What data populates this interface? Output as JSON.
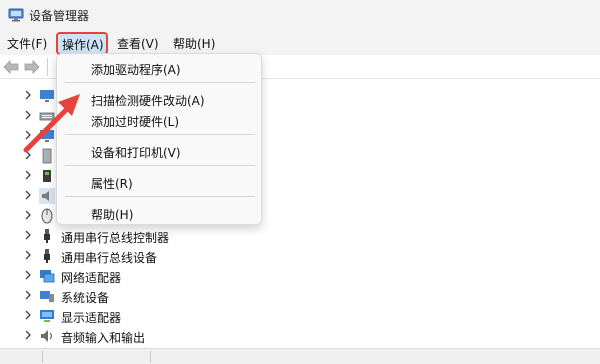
{
  "window": {
    "title": "设备管理器"
  },
  "menubar": {
    "items": [
      {
        "label": "文件(F)"
      },
      {
        "label": "操作(A)"
      },
      {
        "label": "查看(V)"
      },
      {
        "label": "帮助(H)"
      }
    ]
  },
  "action_menu": {
    "items": [
      {
        "label": "添加驱动程序(A)"
      },
      {
        "label": "扫描检测硬件改动(A)"
      },
      {
        "label": "添加过时硬件(L)"
      },
      {
        "label": "设备和打印机(V)"
      },
      {
        "label": "属性(R)"
      },
      {
        "label": "帮助(H)"
      }
    ]
  },
  "tree": {
    "items": [
      {
        "label": "通用串行总线控制器",
        "icon": "usb-icon"
      },
      {
        "label": "通用串行总线设备",
        "icon": "usb-icon"
      },
      {
        "label": "网络适配器",
        "icon": "network-adapter-icon"
      },
      {
        "label": "系统设备",
        "icon": "system-device-icon"
      },
      {
        "label": "显示适配器",
        "icon": "display-adapter-icon"
      },
      {
        "label": "音频输入和输出",
        "icon": "speaker-icon"
      }
    ]
  },
  "colors": {
    "highlight": "#cde4f7",
    "annotation_red": "#e8423c",
    "menu_bg": "#f9f9f9"
  }
}
